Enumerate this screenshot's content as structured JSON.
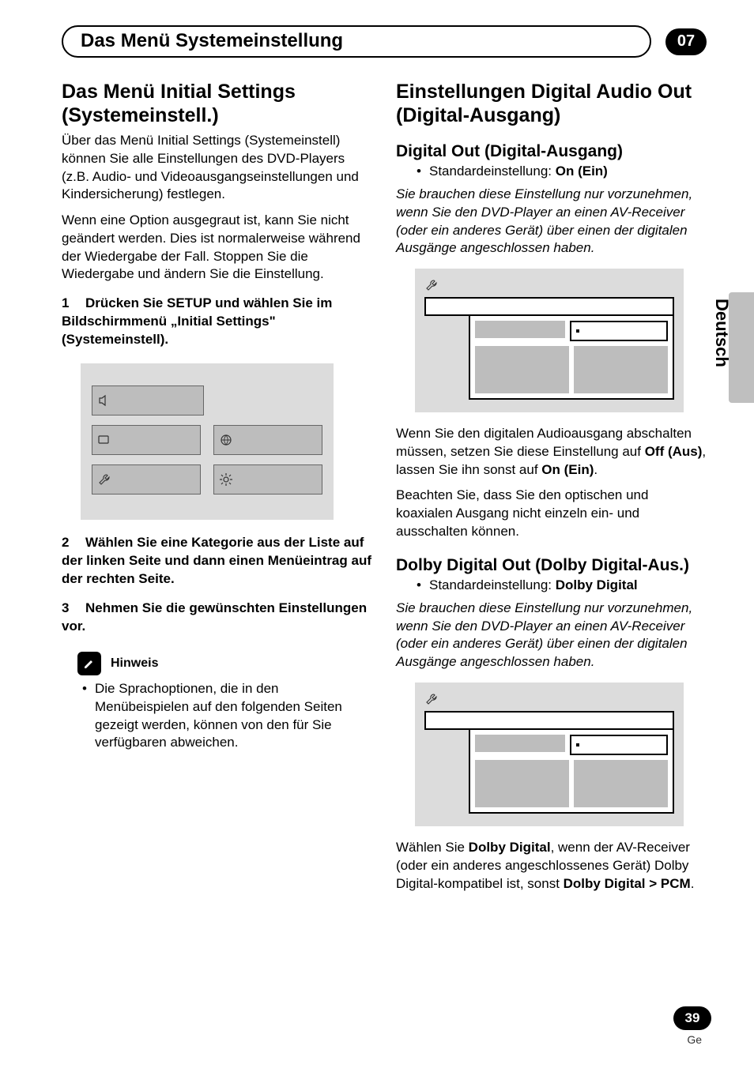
{
  "header": {
    "chapter_title": "Das Menü Systemeinstellung",
    "chapter_number": "07"
  },
  "side": {
    "language_tab": "Deutsch"
  },
  "footer": {
    "page_number": "39",
    "lang_code": "Ge"
  },
  "left": {
    "h1": "Das Menü Initial Settings (Systemeinstell.)",
    "p1": "Über das Menü Initial Settings (Systemeinstell) können Sie alle Einstellungen des DVD-Players (z.B. Audio- und Videoausgangseinstellungen und Kindersicherung) festlegen.",
    "p2": "Wenn eine Option ausgegraut ist, kann Sie nicht geändert werden. Dies ist normalerweise während der Wiedergabe der Fall. Stoppen Sie die Wiedergabe und ändern Sie die Einstellung.",
    "step1_num": "1",
    "step1": "Drücken Sie SETUP und wählen Sie im Bildschirmmenü „Initial Settings\" (Systemeinstell).",
    "step2_num": "2",
    "step2": "Wählen Sie eine Kategorie aus der Liste auf der linken Seite und dann einen Menüeintrag auf der rechten Seite.",
    "step3_num": "3",
    "step3": "Nehmen Sie die gewünschten Einstellungen vor.",
    "hinweis_label": "Hinweis",
    "hinweis_bullet": "Die Sprachoptionen, die in den Menübeispielen auf den folgenden Seiten gezeigt werden, können von den für Sie verfügbaren abweichen."
  },
  "right": {
    "h1": "Einstellungen Digital Audio Out (Digital-Ausgang)",
    "sec1": {
      "h2": "Digital Out (Digital-Ausgang)",
      "default_label": "Standardeinstellung: ",
      "default_value": "On (Ein)",
      "italic": "Sie brauchen diese Einstellung nur vorzunehmen, wenn Sie den DVD-Player an einen AV-Receiver (oder ein anderes Gerät) über einen der digitalen Ausgänge angeschlossen haben.",
      "p_after_1a": "Wenn Sie den digitalen Audioausgang abschalten müssen, setzen Sie diese Einstellung auf ",
      "p_after_1_off": "Off (Aus)",
      "p_after_1b": ", lassen Sie ihn sonst auf ",
      "p_after_1_on": "On (Ein)",
      "p_after_1c": ".",
      "p_after_2": "Beachten Sie, dass Sie den optischen und koaxialen Ausgang nicht einzeln ein- und ausschalten können."
    },
    "sec2": {
      "h2": "Dolby Digital Out (Dolby Digital-Aus.)",
      "default_label": "Standardeinstellung: ",
      "default_value": "Dolby Digital",
      "italic": "Sie brauchen diese Einstellung nur vorzunehmen, wenn Sie den DVD-Player an einen AV-Receiver (oder ein anderes Gerät) über einen der digitalen Ausgänge angeschlossen haben.",
      "p_after_a": "Wählen Sie ",
      "p_after_dd": "Dolby Digital",
      "p_after_b": ", wenn der AV-Receiver (oder ein anderes angeschlossenes Gerät) Dolby Digital-kompatibel ist, sonst ",
      "p_after_pcm": "Dolby Digital > PCM",
      "p_after_c": "."
    }
  }
}
